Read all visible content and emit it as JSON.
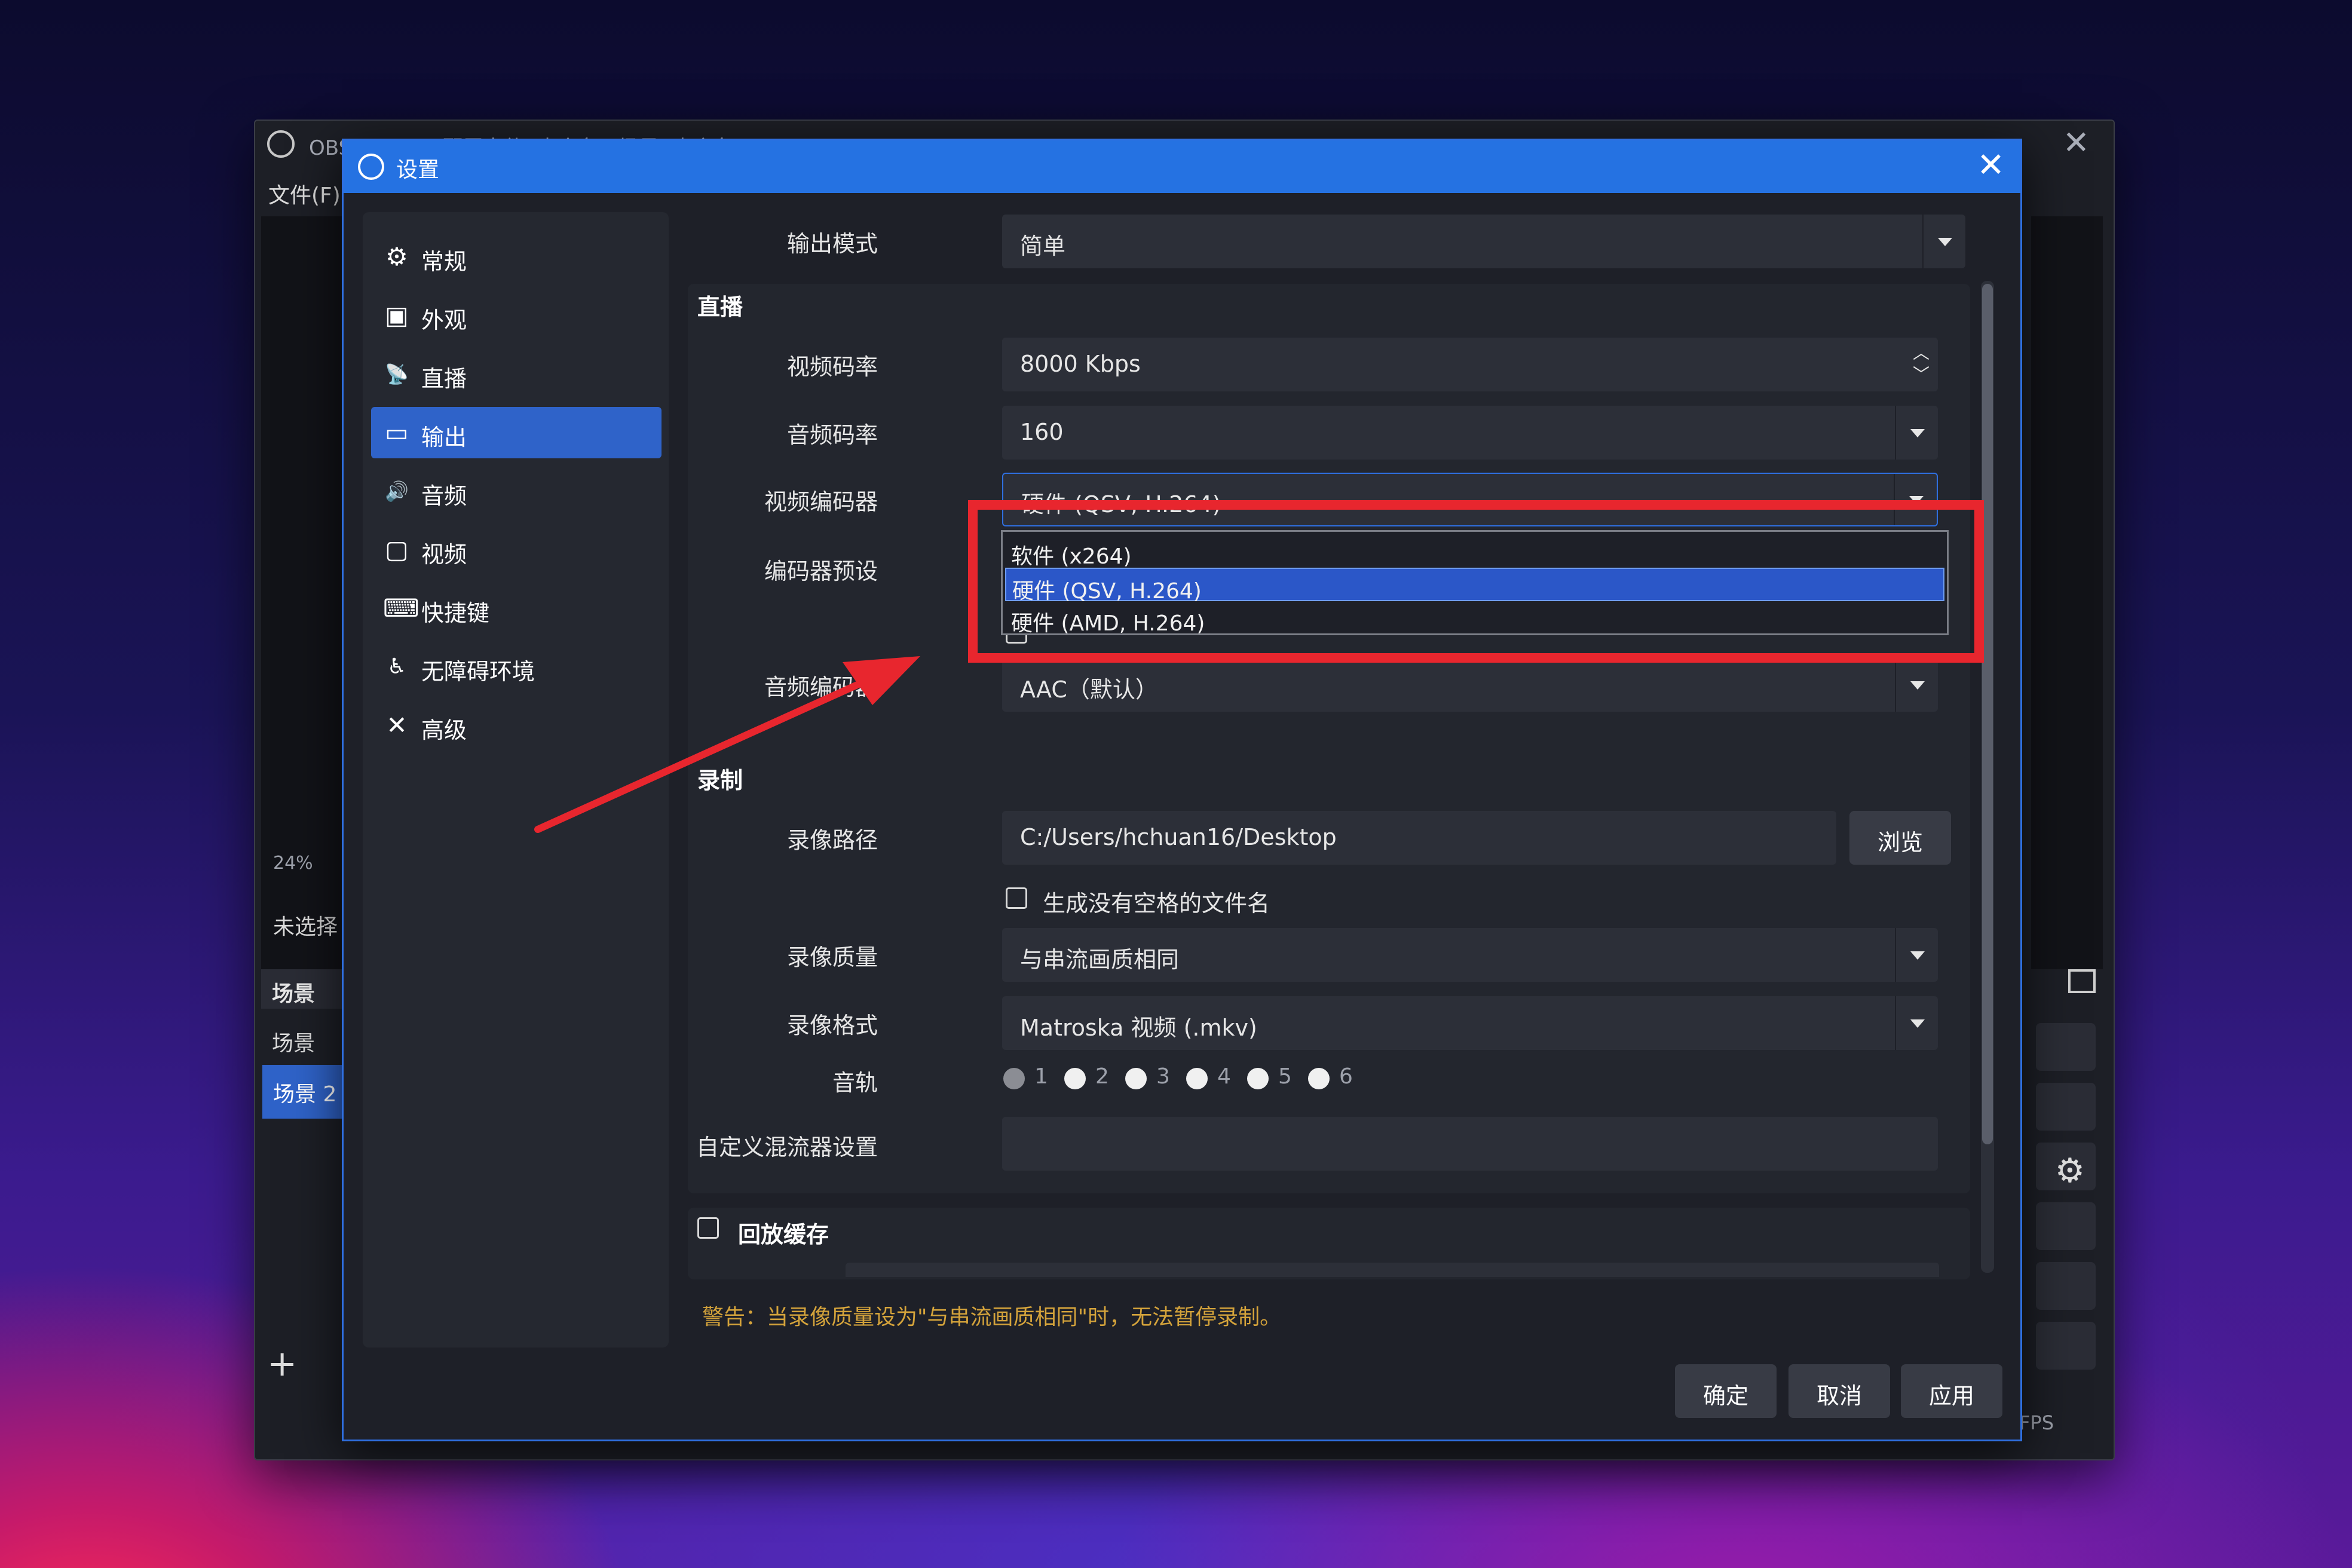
{
  "obs_main": {
    "title": "OBS 31.0.0 - 配置文件: 未命名 - 场景: 未命名",
    "menu_file": "文件(F)",
    "zoom": "24%",
    "no_source": "未选择",
    "scenes_header": "场景",
    "scene_items": [
      "场景",
      "场景 2"
    ],
    "fps_label": "FPS"
  },
  "dialog": {
    "title": "设置",
    "close_glyph": "✕"
  },
  "sidebar": {
    "items": [
      {
        "label": "常规",
        "icon": "gear-icon",
        "glyph": "⚙"
      },
      {
        "label": "外观",
        "icon": "appearance-icon",
        "glyph": "▣"
      },
      {
        "label": "直播",
        "icon": "antenna-icon",
        "glyph": "📡"
      },
      {
        "label": "输出",
        "icon": "output-icon",
        "glyph": "▭"
      },
      {
        "label": "音频",
        "icon": "speaker-icon",
        "glyph": "🔊"
      },
      {
        "label": "视频",
        "icon": "monitor-icon",
        "glyph": "▢"
      },
      {
        "label": "快捷键",
        "icon": "keyboard-icon",
        "glyph": "⌨"
      },
      {
        "label": "无障碍环境",
        "icon": "accessibility-icon",
        "glyph": "♿"
      },
      {
        "label": "高级",
        "icon": "tools-icon",
        "glyph": "✕"
      }
    ],
    "active_index": 3
  },
  "output": {
    "mode_label": "输出模式",
    "mode_value": "简单",
    "streaming": {
      "title": "直播",
      "video_bitrate_label": "视频码率",
      "video_bitrate_value": "8000 Kbps",
      "audio_bitrate_label": "音频码率",
      "audio_bitrate_value": "160",
      "video_encoder_label": "视频编码器",
      "video_encoder_value": "硬件 (QSV, H.264)",
      "encoder_preset_label": "编码器预设",
      "audio_encoder_label": "音频编码器",
      "audio_encoder_value": "AAC（默认）"
    },
    "encoder_options": [
      "软件 (x264)",
      "硬件 (QSV, H.264)",
      "硬件 (AMD, H.264)"
    ],
    "encoder_selected_index": 1,
    "recording": {
      "title": "录制",
      "path_label": "录像路径",
      "path_value": "C:/Users/hchuan16/Desktop",
      "browse_label": "浏览",
      "no_space_label": "生成没有空格的文件名",
      "quality_label": "录像质量",
      "quality_value": "与串流画质相同",
      "format_label": "录像格式",
      "format_value": "Matroska 视频 (.mkv)",
      "tracks_label": "音轨",
      "tracks": [
        "1",
        "2",
        "3",
        "4",
        "5",
        "6"
      ],
      "mixer_label": "自定义混流器设置",
      "mixer_value": ""
    },
    "replay_buffer_label": "回放缓存",
    "warning": "警告：当录像质量设为\"与串流画质相同\"时，无法暂停录制。"
  },
  "buttons": {
    "ok": "确定",
    "cancel": "取消",
    "apply": "应用"
  },
  "colors": {
    "accent": "#2572e2",
    "selection": "#2f63c9",
    "highlight_box": "#e8262e",
    "warning_text": "#d4a33b"
  }
}
